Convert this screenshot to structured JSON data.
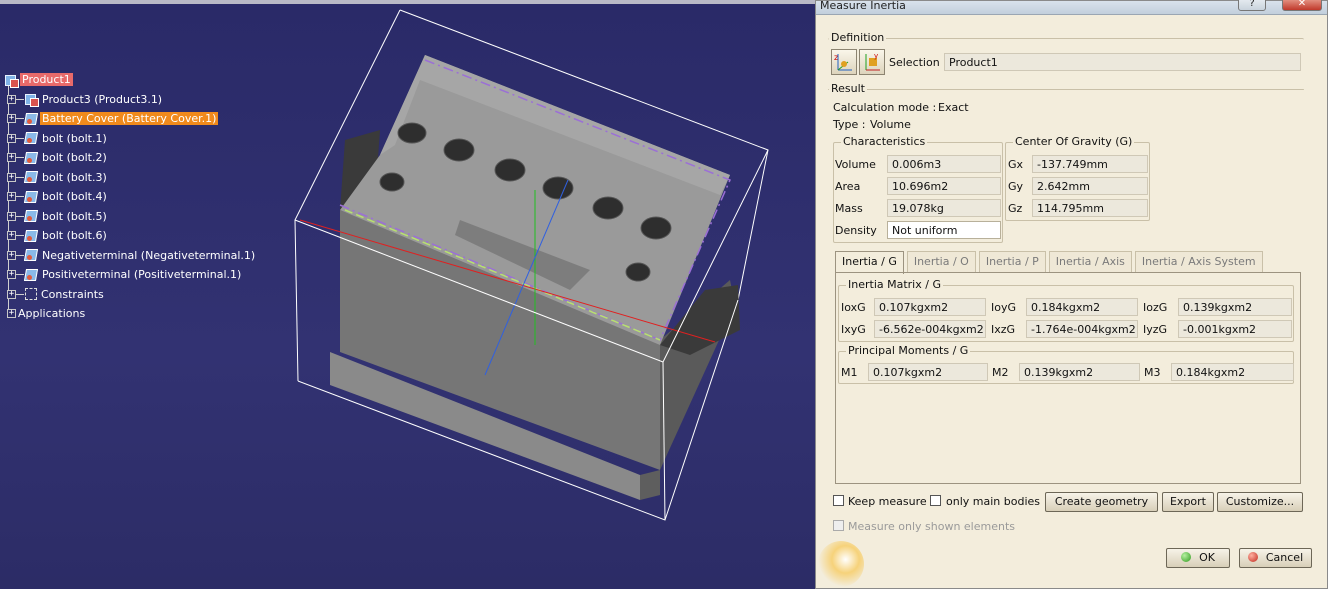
{
  "tree": {
    "items": [
      {
        "label": "Product1",
        "icon": "product-icon",
        "state": "selected"
      },
      {
        "label": "Product3 (Product3.1)",
        "icon": "product-icon"
      },
      {
        "label": "Battery Cover (Battery Cover.1)",
        "icon": "part-icon",
        "state": "highlight"
      },
      {
        "label": "bolt (bolt.1)",
        "icon": "part-icon"
      },
      {
        "label": "bolt (bolt.2)",
        "icon": "part-icon"
      },
      {
        "label": "bolt (bolt.3)",
        "icon": "part-icon"
      },
      {
        "label": "bolt (bolt.4)",
        "icon": "part-icon"
      },
      {
        "label": "bolt (bolt.5)",
        "icon": "part-icon"
      },
      {
        "label": "bolt (bolt.6)",
        "icon": "part-icon"
      },
      {
        "label": "Negativeterminal (Negativeterminal.1)",
        "icon": "part-icon"
      },
      {
        "label": "Positiveterminal (Positiveterminal.1)",
        "icon": "part-icon"
      },
      {
        "label": "Constraints",
        "icon": "constraints-icon"
      },
      {
        "label": "Applications",
        "icon": "applications-icon"
      }
    ]
  },
  "dialog": {
    "title": "Measure Inertia",
    "definition": {
      "label": "Definition",
      "selection_label": "Selection :",
      "selection_value": "Product1"
    },
    "result": {
      "label": "Result",
      "calc_mode_label": "Calculation mode :",
      "calc_mode_value": "Exact",
      "type_label": "Type :",
      "type_value": "Volume"
    },
    "characteristics": {
      "label": "Characteristics",
      "volume_label": "Volume",
      "volume_value": "0.006m3",
      "area_label": "Area",
      "area_value": "10.696m2",
      "mass_label": "Mass",
      "mass_value": "19.078kg",
      "density_label": "Density",
      "density_value": "Not uniform"
    },
    "cog": {
      "label": "Center Of Gravity (G)",
      "gx_label": "Gx",
      "gx_value": "-137.749mm",
      "gy_label": "Gy",
      "gy_value": "2.642mm",
      "gz_label": "Gz",
      "gz_value": "114.795mm"
    },
    "tabs": [
      "Inertia / G",
      "Inertia / O",
      "Inertia / P",
      "Inertia / Axis",
      "Inertia / Axis System"
    ],
    "matrix": {
      "label": "Inertia Matrix / G",
      "ioxg_label": "IoxG",
      "ioxg_value": "0.107kgxm2",
      "ioyg_label": "IoyG",
      "ioyg_value": "0.184kgxm2",
      "iozg_label": "IozG",
      "iozg_value": "0.139kgxm2",
      "ixyg_label": "IxyG",
      "ixyg_value": "-6.562e-004kgxm2",
      "ixzg_label": "IxzG",
      "ixzg_value": "-1.764e-004kgxm2",
      "iyzg_label": "IyzG",
      "iyzg_value": "-0.001kgxm2"
    },
    "principal": {
      "label": "Principal Moments / G",
      "m1_label": "M1",
      "m1_value": "0.107kgxm2",
      "m2_label": "M2",
      "m2_value": "0.139kgxm2",
      "m3_label": "M3",
      "m3_value": "0.184kgxm2"
    },
    "options": {
      "keep_measure": "Keep measure",
      "only_main_bodies": "only main bodies",
      "measure_only_shown": "Measure only shown elements"
    },
    "buttons": {
      "create_geometry": "Create geometry",
      "export": "Export",
      "customize": "Customize...",
      "ok": "OK",
      "cancel": "Cancel"
    }
  }
}
